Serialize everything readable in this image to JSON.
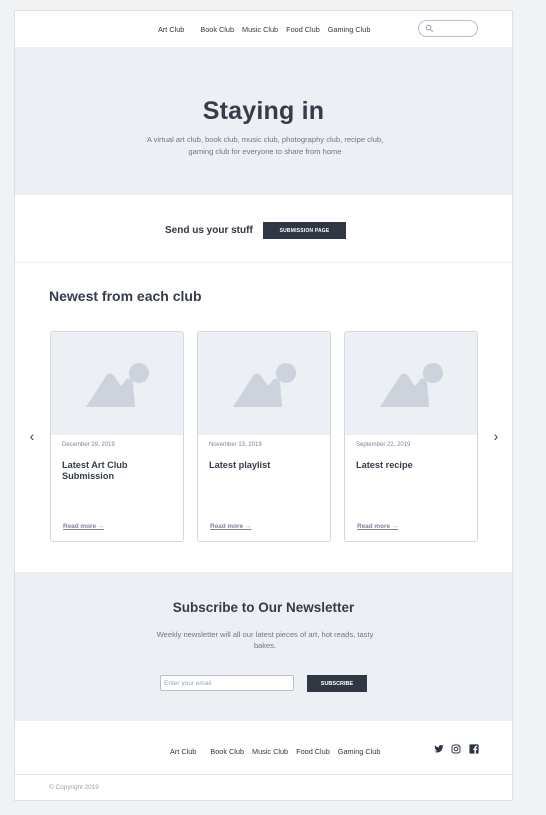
{
  "nav": {
    "links": [
      "Art Club",
      "Book Club",
      "Music Club",
      "Food Club",
      "Gaming Club"
    ]
  },
  "hero": {
    "title": "Staying in",
    "subtitle": "A virtual art club, book club, music club, photography club, recipe club, gaming club for everyone to share from home"
  },
  "submission": {
    "label": "Send us your stuff",
    "button": "SUBMISSION PAGE"
  },
  "newest": {
    "heading": "Newest from each club",
    "prev_arrow": "‹",
    "next_arrow": "›",
    "cards": [
      {
        "date": "December 29, 2019",
        "title": "Latest Art Club Submission",
        "link": "Read more →"
      },
      {
        "date": "November 13, 2019",
        "title": "Latest playlist",
        "link": "Read more →"
      },
      {
        "date": "September 22, 2019",
        "title": "Latest recipe",
        "link": "Read more →"
      }
    ]
  },
  "newsletter": {
    "heading": "Subscribe to Our Newsletter",
    "text": "Weekly newsletter will all our latest pieces of art, hot reads, tasty bakes.",
    "email_placeholder": "Enter your email",
    "button": "SUBSCRIBE"
  },
  "footer": {
    "links": [
      "Art Club",
      "Book Club",
      "Music Club",
      "Food Club",
      "Gaming Club"
    ],
    "social_icons": [
      "twitter-icon",
      "instagram-icon",
      "facebook-icon"
    ],
    "copyright": "© Copyright 2019"
  },
  "colors": {
    "dark": "#2f3744",
    "hero_bg": "#eceff3",
    "muted": "#6d7888"
  }
}
